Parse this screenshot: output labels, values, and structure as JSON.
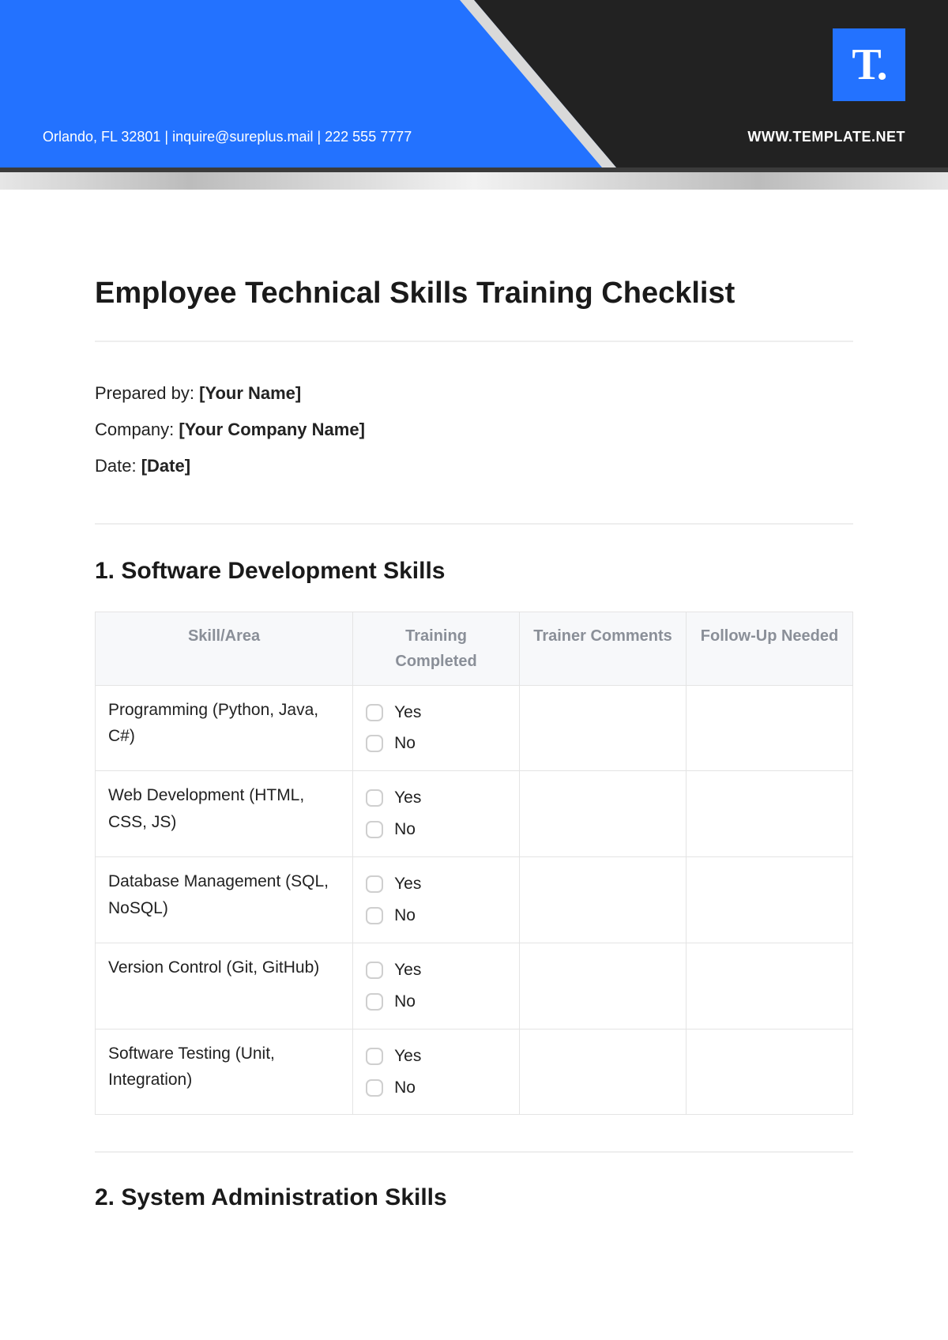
{
  "header": {
    "contact": "Orlando, FL 32801 | inquire@sureplus.mail | 222 555 7777",
    "url": "WWW.TEMPLATE.NET",
    "logo_letter": "T."
  },
  "title": "Employee Technical Skills Training Checklist",
  "meta": {
    "prepared_by_label": "Prepared by: ",
    "prepared_by_value": "[Your Name]",
    "company_label": "Company: ",
    "company_value": "[Your Company Name]",
    "date_label": "Date: ",
    "date_value": "[Date]"
  },
  "sections": [
    {
      "heading": "1. Software Development Skills",
      "columns": [
        "Skill/Area",
        "Training Completed",
        "Trainer Comments",
        "Follow-Up Needed"
      ],
      "yes_label": "Yes",
      "no_label": "No",
      "rows": [
        "Programming (Python, Java, C#)",
        "Web Development (HTML, CSS, JS)",
        "Database Management (SQL, NoSQL)",
        "Version Control (Git, GitHub)",
        "Software Testing (Unit, Integration)"
      ]
    },
    {
      "heading": "2. System Administration Skills"
    }
  ]
}
